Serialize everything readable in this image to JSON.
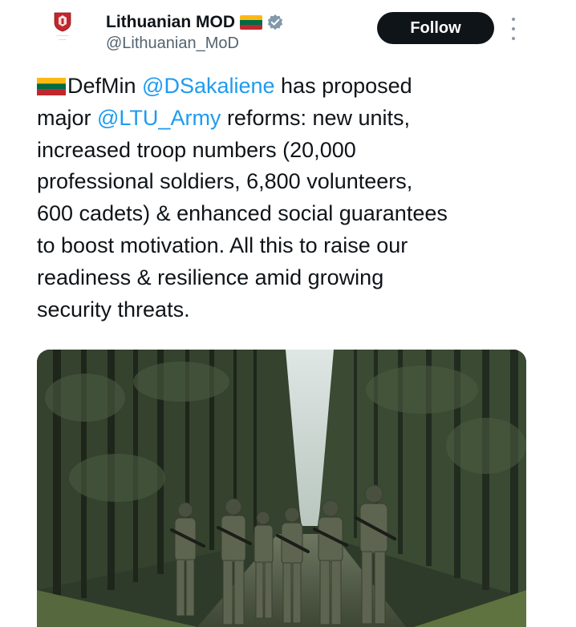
{
  "account": {
    "display_name": "Lithuanian MOD",
    "handle": "@Lithuanian_MoD",
    "verified": true,
    "avatar_icon": "lithuanian-mod-emblem-icon",
    "name_flag_icon": "lithuania-flag-icon"
  },
  "actions": {
    "follow_label": "Follow",
    "more_icon": "more-vertical-icon"
  },
  "tweet": {
    "flag_icon": "lithuania-flag-icon",
    "line1": {
      "prefix": "DefMin ",
      "mention": "@DSakaliene",
      "suffix": " has proposed"
    },
    "line2": {
      "prefix": "major ",
      "mention": "@LTU_Army",
      "suffix": " reforms: new units,"
    },
    "line3": "increased troop numbers (20,000",
    "line4": "professional soldiers, 6,800 volunteers,",
    "line5": "600 cadets) & enhanced social guarantees",
    "line6": "to boost motivation. All this to raise our",
    "line7": "readiness & resilience amid growing",
    "line8": "security threats."
  },
  "media": {
    "kind": "photo"
  },
  "colors": {
    "link": "#1d9bf0",
    "text": "#0f1419",
    "secondary": "#536471",
    "follow_bg": "#0f1419",
    "verified": "#829aab",
    "flag_yellow": "#fdb913",
    "flag_green": "#006a44",
    "flag_red": "#c1272d"
  }
}
